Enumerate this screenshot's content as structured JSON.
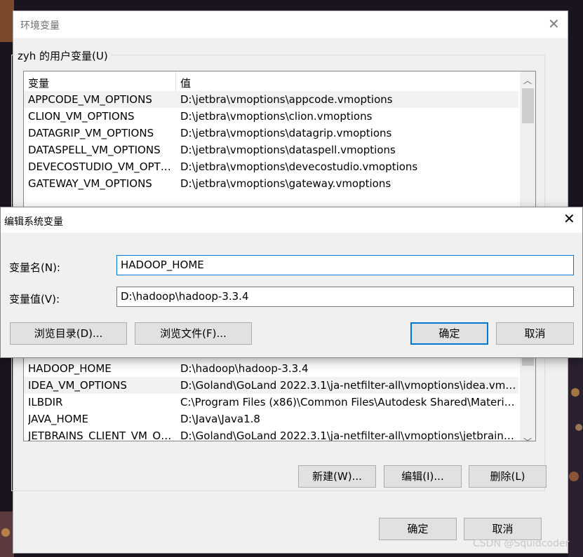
{
  "env_window": {
    "title": "环境变量",
    "group_title": "zyh 的用户变量(U)",
    "columns": {
      "name": "变量",
      "value": "值"
    },
    "user_vars_top": [
      {
        "name": "APPCODE_VM_OPTIONS",
        "value": "D:\\jetbra\\vmoptions\\appcode.vmoptions"
      },
      {
        "name": "CLION_VM_OPTIONS",
        "value": "D:\\jetbra\\vmoptions\\clion.vmoptions"
      },
      {
        "name": "DATAGRIP_VM_OPTIONS",
        "value": "D:\\jetbra\\vmoptions\\datagrip.vmoptions"
      },
      {
        "name": "DATASPELL_VM_OPTIONS",
        "value": "D:\\jetbra\\vmoptions\\dataspell.vmoptions"
      },
      {
        "name": "DEVECOSTUDIO_VM_OPTI...",
        "value": "D:\\jetbra\\vmoptions\\devecostudio.vmoptions"
      },
      {
        "name": "GATEWAY_VM_OPTIONS",
        "value": "D:\\jetbra\\vmoptions\\gateway.vmoptions"
      }
    ],
    "system_vars_visible": [
      {
        "name": "HADOOP_HOME",
        "value": "D:\\hadoop\\hadoop-3.3.4"
      },
      {
        "name": "IDEA_VM_OPTIONS",
        "value": "D:\\Goland\\GoLand 2022.3.1\\ja-netfilter-all\\vmoptions\\idea.vmo..."
      },
      {
        "name": "ILBDIR",
        "value": "C:\\Program Files (x86)\\Common Files\\Autodesk Shared\\Materia..."
      },
      {
        "name": "JAVA_HOME",
        "value": "D:\\Java\\Java1.8"
      },
      {
        "name": "JETBRAINS_CLIENT_VM_OP...",
        "value": "D:\\Goland\\GoLand 2022.3.1\\ja-netfilter-all\\vmoptions\\jetbrains..."
      }
    ],
    "buttons": {
      "new": "新建(W)...",
      "edit": "编辑(I)...",
      "delete": "删除(L)",
      "ok": "确定",
      "cancel": "取消"
    }
  },
  "edit_dialog": {
    "title": "编辑系统变量",
    "name_label": "变量名(N):",
    "value_label": "变量值(V):",
    "name_value": "HADOOP_HOME",
    "value_value": "D:\\hadoop\\hadoop-3.3.4",
    "buttons": {
      "browse_dir": "浏览目录(D)...",
      "browse_file": "浏览文件(F)...",
      "ok": "确定",
      "cancel": "取消"
    }
  },
  "watermark": "CSDN @Squidcoder",
  "colors": {
    "accent": "#0078d7",
    "selected_row": "#f2f2f2",
    "button": "#e1e1e1"
  }
}
